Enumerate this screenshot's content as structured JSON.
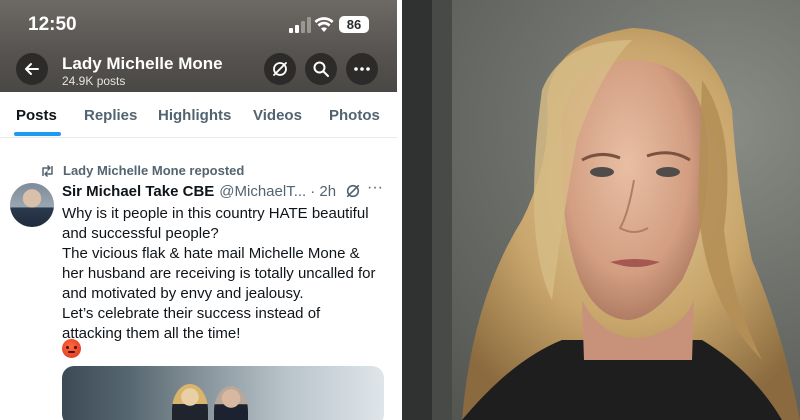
{
  "status_bar": {
    "time": "12:50",
    "battery": "86"
  },
  "profile": {
    "name": "Lady Michelle Mone",
    "post_count": "24.9K posts"
  },
  "tabs": [
    "Posts",
    "Replies",
    "Highlights",
    "Videos",
    "Photos"
  ],
  "tweet": {
    "repost_label": "Lady Michelle Mone reposted",
    "author_name": "Sir Michael Take CBE",
    "author_handle": "@MichaelT...",
    "time": "· 2h",
    "more": "···",
    "lines": [
      "Why is it people in this country HATE beautiful",
      "and successful people?",
      "The vicious flak & hate mail Michelle Mone &",
      "her husband are receiving is totally uncalled for",
      "and motivated by envy and jealousy.",
      "Let’s celebrate their success instead of",
      "attacking them all the time!"
    ],
    "emoji": "angry-face"
  },
  "icons": [
    "back-arrow-icon",
    "notifications-off-icon",
    "search-icon",
    "more-icon",
    "repost-icon",
    "signal-icon",
    "wifi-icon",
    "battery-icon"
  ],
  "colors": {
    "accent": "#1d9bf0",
    "text": "#0f1419",
    "muted": "#536471",
    "header": "#55524f"
  },
  "photo": {
    "subject": "blonde-woman-portrait"
  }
}
